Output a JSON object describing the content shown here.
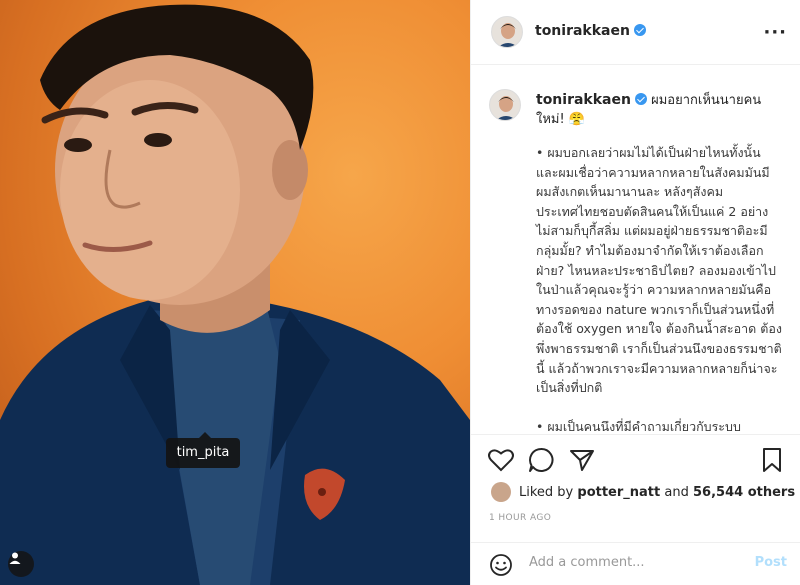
{
  "photo": {
    "tag_label": "tim_pita"
  },
  "header": {
    "username": "tonirakkaen",
    "more_label": "···"
  },
  "caption": {
    "username": "tonirakkaen",
    "lead": "ผมอยากเห็นนายคนใหม่! 😤",
    "body": "• ผมบอกเลยว่าผมไม่ได้เป็นฝ่ายไหนทั้งนั้น และผมเชื่อว่าความหลากหลายในสังคมมันมี ผมสังเกตเห็นมานานละ หลังๆสังคมประเทศไทยชอบตัดสินคนให้เป็นแค่ 2 อย่าง ไม่สามก็บุกี้สลิ่ม แต่ผมอยู่ฝ่ายธรรมชาติอะมีกลุ่มมั้ย? ทำไมต้องมาจำกัดให้เราต้องเลือกฝ่าย? ไหนหละประชาธิปไตย? ลองมองเข้าไปในป่าแล้วคุณจะรู้ว่า ความหลากหลายมันคือทางรอดของ nature พวกเราก็เป็นส่วนหนึ่งที่ต้องใช้ oxygen หายใจ ต้องกินน้ำสะอาด ต้องพึ่งพาธรรมชาติ เราก็เป็นส่วนนึงของธรรมชาตินี้ แล้วถ้าพวกเราจะมีความหลากหลายก็น่าจะเป็นสิ่งที่ปกติ\n\n• ผมเป็นคนนึงที่มีคำถามเกี่ยวกับระบบ"
  },
  "likes": {
    "prefix": "Liked by",
    "user": "potter_natt",
    "and": "and",
    "count": "56,544 others"
  },
  "time": "1 HOUR AGO",
  "add_comment": {
    "placeholder": "Add a comment...",
    "post_label": "Post"
  },
  "colors": {
    "accent": "#3897f0",
    "post_disabled": "#b2dffc",
    "background_photo": "#ef8e34"
  },
  "icons": [
    "heart-icon",
    "comment-icon",
    "share-icon",
    "bookmark-icon",
    "emoji-icon",
    "more-icon",
    "verified-icon",
    "user-tag-icon"
  ]
}
